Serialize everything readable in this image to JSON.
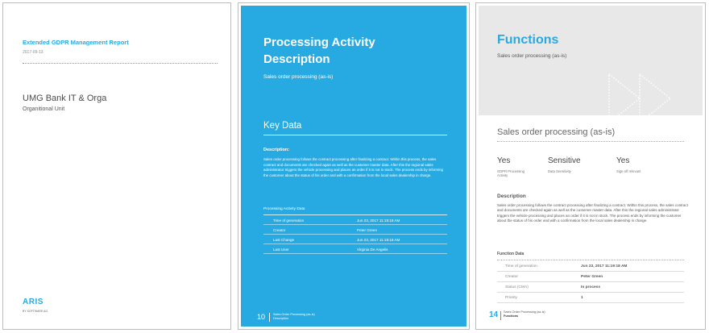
{
  "page1": {
    "report_title": "Extended GDPR Management Report",
    "date": "2017-09-13",
    "unit_name": "UMG Bank IT & Orga",
    "unit_type": "Organitional Unit",
    "logo": "ARIS",
    "logo_sub": "BY SOFTWARE AG"
  },
  "page2": {
    "title_line1": "Processing Activity",
    "title_line2": "Description",
    "subtitle": "Sales order processing (as-is)",
    "key_data": "Key Data",
    "description_heading": "Description:",
    "description": "Sales order processing follows the contract processing after finalizing a contract. Within this process, the sales contract and documents are checked again as well as the customer master data. After this the regional sales administrator triggers the vehicle processing and places an order if it is not in stock. The process ends by informing the customer about the status of his order and with a confirmation from the local sales dealership in charge.",
    "table_heading": "Processing Activity Data",
    "rows": [
      {
        "label": "Time of generation",
        "value": "Jun 23, 2017 11:19:18 AM"
      },
      {
        "label": "Creator",
        "value": "Peter Green"
      },
      {
        "label": "Last Change",
        "value": "Jun 23, 2017 11:19:18 AM"
      },
      {
        "label": "Last User",
        "value": "Virginia De Angelis"
      }
    ],
    "footer_page": "10",
    "footer_line1": "Sales Order Processing (as-is)",
    "footer_line2": "Description"
  },
  "page3": {
    "title": "Functions",
    "subtitle": "Sales order processing (as-is)",
    "section_title": "Sales order processing (as-is)",
    "kpis": [
      {
        "value": "Yes",
        "label": "GDPR Processing Activity"
      },
      {
        "value": "Sensitive",
        "label": "Data Sensitivity"
      },
      {
        "value": "Yes",
        "label": "Sign-off relevant"
      }
    ],
    "description_heading": "Description",
    "description": "Sales order processing follows the contract processing after finalizing a contract. Within this process, the sales contract and documents are checked again as well as the customer master data. After this the regional sales administrator triggers the vehicle processing and places an order if it is not in stock. The process ends by informing the customer about the status of his order and with a confirmation from the local sales dealership in charge.",
    "table_heading": "Function Data",
    "rows": [
      {
        "label": "Time of generation",
        "value": "Jun 23, 2017 11:19:18 AM"
      },
      {
        "label": "Creator",
        "value": "Peter Green"
      },
      {
        "label": "Status (CMA)",
        "value": "In process"
      },
      {
        "label": "Priority",
        "value": "1"
      }
    ],
    "footer_page": "14",
    "footer_line1": "Sales Order Processing (as-is)",
    "footer_line2": "Functions"
  },
  "colors": {
    "accent": "#27aae1",
    "header_grey": "#e8e8e8"
  },
  "icons": {
    "page3_graphic": "double-chevron-right-icon"
  }
}
